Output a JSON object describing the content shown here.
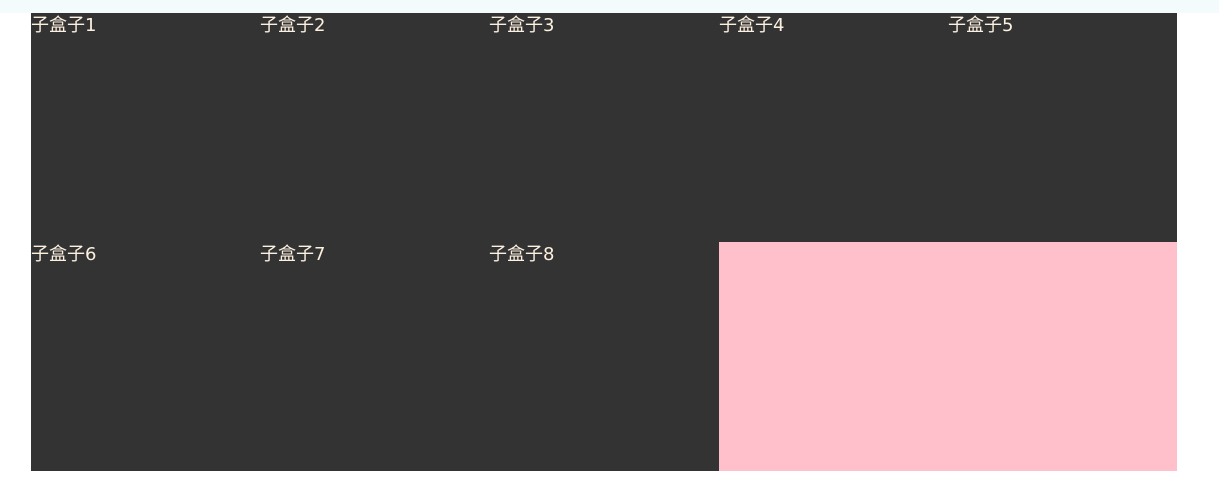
{
  "parent": {
    "background": "#333333",
    "remainder_background": "#ffc0cb"
  },
  "boxes": [
    {
      "label": "子盒子1"
    },
    {
      "label": "子盒子2"
    },
    {
      "label": "子盒子3"
    },
    {
      "label": "子盒子4"
    },
    {
      "label": "子盒子5"
    },
    {
      "label": "子盒子6"
    },
    {
      "label": "子盒子7"
    },
    {
      "label": "子盒子8"
    }
  ],
  "colors": {
    "label_text": "#fcf0e0",
    "page_background": "#ffffff"
  }
}
